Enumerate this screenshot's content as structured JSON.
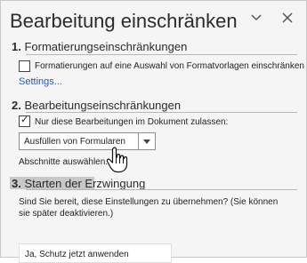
{
  "pane": {
    "title": "Bearbeitung einschränken",
    "icons": {
      "options": "chevron-down-icon",
      "close": "close-icon"
    }
  },
  "section1": {
    "number": "1.",
    "title": "Formatierungseinschränkungen",
    "checkbox_label": "Formatierungen auf eine Auswahl von Formatvorlagen einschränken",
    "checkbox_checked": false,
    "settings_link": "Settings..."
  },
  "section2": {
    "number": "2.",
    "title": "Bearbeitungseinschränkungen",
    "checkbox_label": "Nur diese Bearbeitungen im Dokument zulassen:",
    "checkbox_checked": true,
    "dropdown_value": "Ausfüllen von Formularen",
    "sections_link": "Abschnitte auswählen..."
  },
  "section3": {
    "number": "3.",
    "title": "Starten der Erzwingung",
    "description": "Sind Sie bereit, diese Einstellungen zu übernehmen? (Sie können sie später deaktivieren.)",
    "button_label": "Ja, Schutz jetzt anwenden"
  },
  "colors": {
    "link": "#2b579a",
    "pane_bg": "#f5f5f5",
    "selection": "#c8c8c8"
  }
}
